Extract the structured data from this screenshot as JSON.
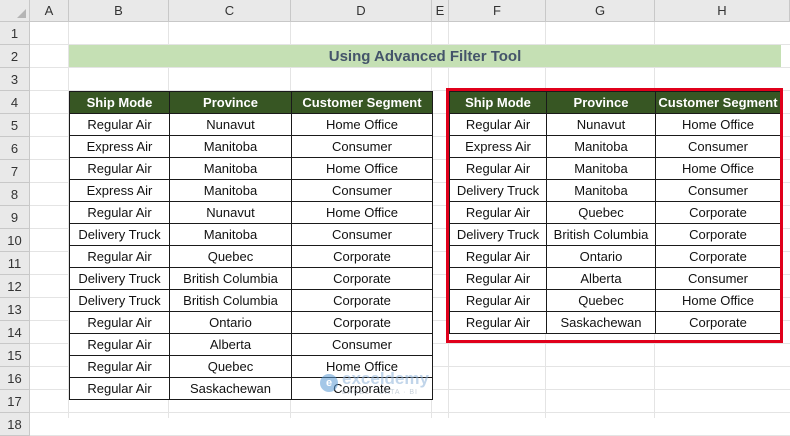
{
  "columns": [
    "A",
    "B",
    "C",
    "D",
    "E",
    "F",
    "G",
    "H"
  ],
  "rows": [
    "1",
    "2",
    "3",
    "4",
    "5",
    "6",
    "7",
    "8",
    "9",
    "10",
    "11",
    "12",
    "13",
    "14",
    "15",
    "16",
    "17",
    "18"
  ],
  "title": "Using Advanced Filter Tool",
  "left_table": {
    "headers": [
      "Ship Mode",
      "Province",
      "Customer Segment"
    ],
    "rows": [
      [
        "Regular Air",
        "Nunavut",
        "Home Office"
      ],
      [
        "Express Air",
        "Manitoba",
        "Consumer"
      ],
      [
        "Regular Air",
        "Manitoba",
        "Home Office"
      ],
      [
        "Express Air",
        "Manitoba",
        "Consumer"
      ],
      [
        "Regular Air",
        "Nunavut",
        "Home Office"
      ],
      [
        "Delivery Truck",
        "Manitoba",
        "Consumer"
      ],
      [
        "Regular Air",
        "Quebec",
        "Corporate"
      ],
      [
        "Delivery Truck",
        "British Columbia",
        "Corporate"
      ],
      [
        "Delivery Truck",
        "British Columbia",
        "Corporate"
      ],
      [
        "Regular Air",
        "Ontario",
        "Corporate"
      ],
      [
        "Regular Air",
        "Alberta",
        "Consumer"
      ],
      [
        "Regular Air",
        "Quebec",
        "Home Office"
      ],
      [
        "Regular Air",
        "Saskachewan",
        "Corporate"
      ]
    ]
  },
  "right_table": {
    "headers": [
      "Ship Mode",
      "Province",
      "Customer Segment"
    ],
    "rows": [
      [
        "Regular Air",
        "Nunavut",
        "Home Office"
      ],
      [
        "Express Air",
        "Manitoba",
        "Consumer"
      ],
      [
        "Regular Air",
        "Manitoba",
        "Home Office"
      ],
      [
        "Delivery Truck",
        "Manitoba",
        "Consumer"
      ],
      [
        "Regular Air",
        "Quebec",
        "Corporate"
      ],
      [
        "Delivery Truck",
        "British Columbia",
        "Corporate"
      ],
      [
        "Regular Air",
        "Ontario",
        "Corporate"
      ],
      [
        "Regular Air",
        "Alberta",
        "Consumer"
      ],
      [
        "Regular Air",
        "Quebec",
        "Home Office"
      ],
      [
        "Regular Air",
        "Saskachewan",
        "Corporate"
      ]
    ]
  },
  "watermark": {
    "icon_letter": "e",
    "name": "exceldemy",
    "tagline": "EXCEL · DATA · BI"
  },
  "colors": {
    "header_fill": "#375623",
    "title_fill": "#c5e0b4",
    "title_text": "#44546a",
    "highlight_border": "#e0001b"
  }
}
